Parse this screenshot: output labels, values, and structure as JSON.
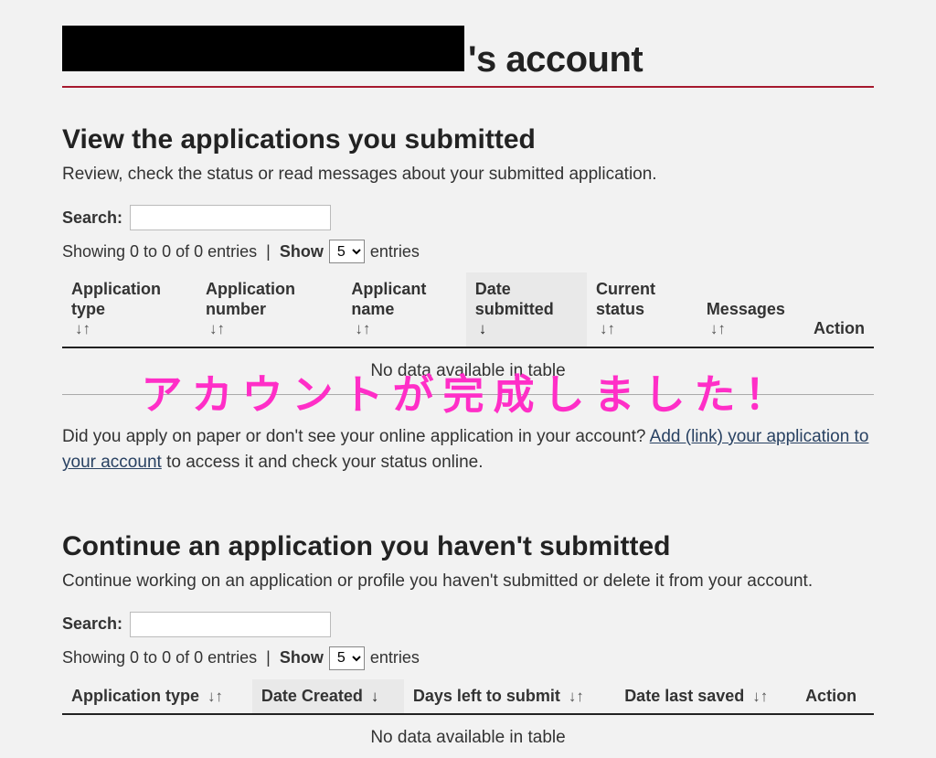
{
  "header": {
    "title_suffix": "'s account"
  },
  "overlay": {
    "text": "アカウントが完成しました！"
  },
  "submitted": {
    "heading": "View the applications you submitted",
    "sub": "Review, check the status or read messages about your submitted application.",
    "search_label": "Search:",
    "showing_text": "Showing 0 to 0 of 0 entries",
    "show_label": "Show",
    "entries_word": "entries",
    "entries_value": "5",
    "columns": {
      "c1": "Application type",
      "c2": "Application number",
      "c3": "Applicant name",
      "c4": "Date submitted",
      "c5": "Current status",
      "c6": "Messages",
      "c7": "Action"
    },
    "empty_text": "No data available in table",
    "below_text_1": "Did you apply on paper or don't see your online application in your account? ",
    "below_link": "Add (link) your application to your account",
    "below_text_2": " to access it and check your status online."
  },
  "unsubmitted": {
    "heading": "Continue an application you haven't submitted",
    "sub": "Continue working on an application or profile you haven't submitted or delete it from your account.",
    "search_label": "Search:",
    "showing_text": "Showing 0 to 0 of 0 entries",
    "show_label": "Show",
    "entries_word": "entries",
    "entries_value": "5",
    "columns": {
      "c1": "Application type",
      "c2": "Date Created",
      "c3": "Days left to submit",
      "c4": "Date last saved",
      "c5": "Action"
    },
    "empty_text": "No data available in table"
  }
}
